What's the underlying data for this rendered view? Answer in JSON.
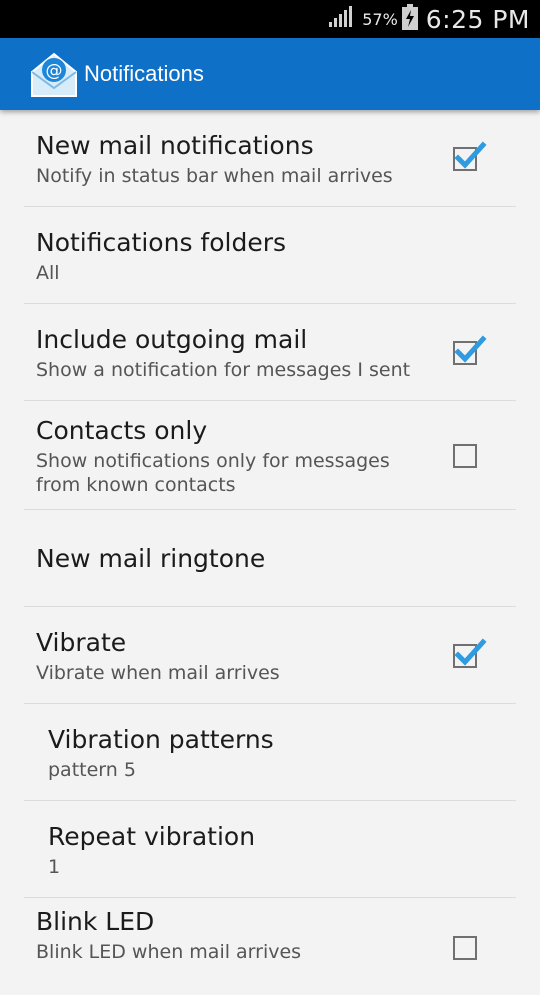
{
  "status_bar": {
    "battery_percent": "57%",
    "time": "6:25 PM",
    "icons": [
      "signal-icon",
      "battery-charging-icon"
    ]
  },
  "action_bar": {
    "title": "Notifications",
    "icon": "mail-app-icon"
  },
  "colors": {
    "action_bar": "#0f70c7",
    "checkmark": "#2f9be0",
    "background": "#f3f3f3"
  },
  "preferences": [
    {
      "title": "New mail notifications",
      "summary": "Notify in status bar when mail arrives",
      "checked": true
    },
    {
      "title": "Notifications folders",
      "summary": "All"
    },
    {
      "title": "Include outgoing mail",
      "summary": "Show a notification for messages I sent",
      "checked": true
    },
    {
      "title": "Contacts only",
      "summary_line1": "Show notifications only for messages",
      "summary_line2": "from known contacts",
      "checked": false
    },
    {
      "title": "New mail ringtone"
    },
    {
      "title": "Vibrate",
      "summary": "Vibrate when mail arrives",
      "checked": true
    },
    {
      "title": "Vibration patterns",
      "summary": "pattern 5"
    },
    {
      "title": "Repeat vibration",
      "summary": "1"
    },
    {
      "title": "Blink LED",
      "summary": "Blink LED when mail arrives",
      "checked": false
    }
  ]
}
